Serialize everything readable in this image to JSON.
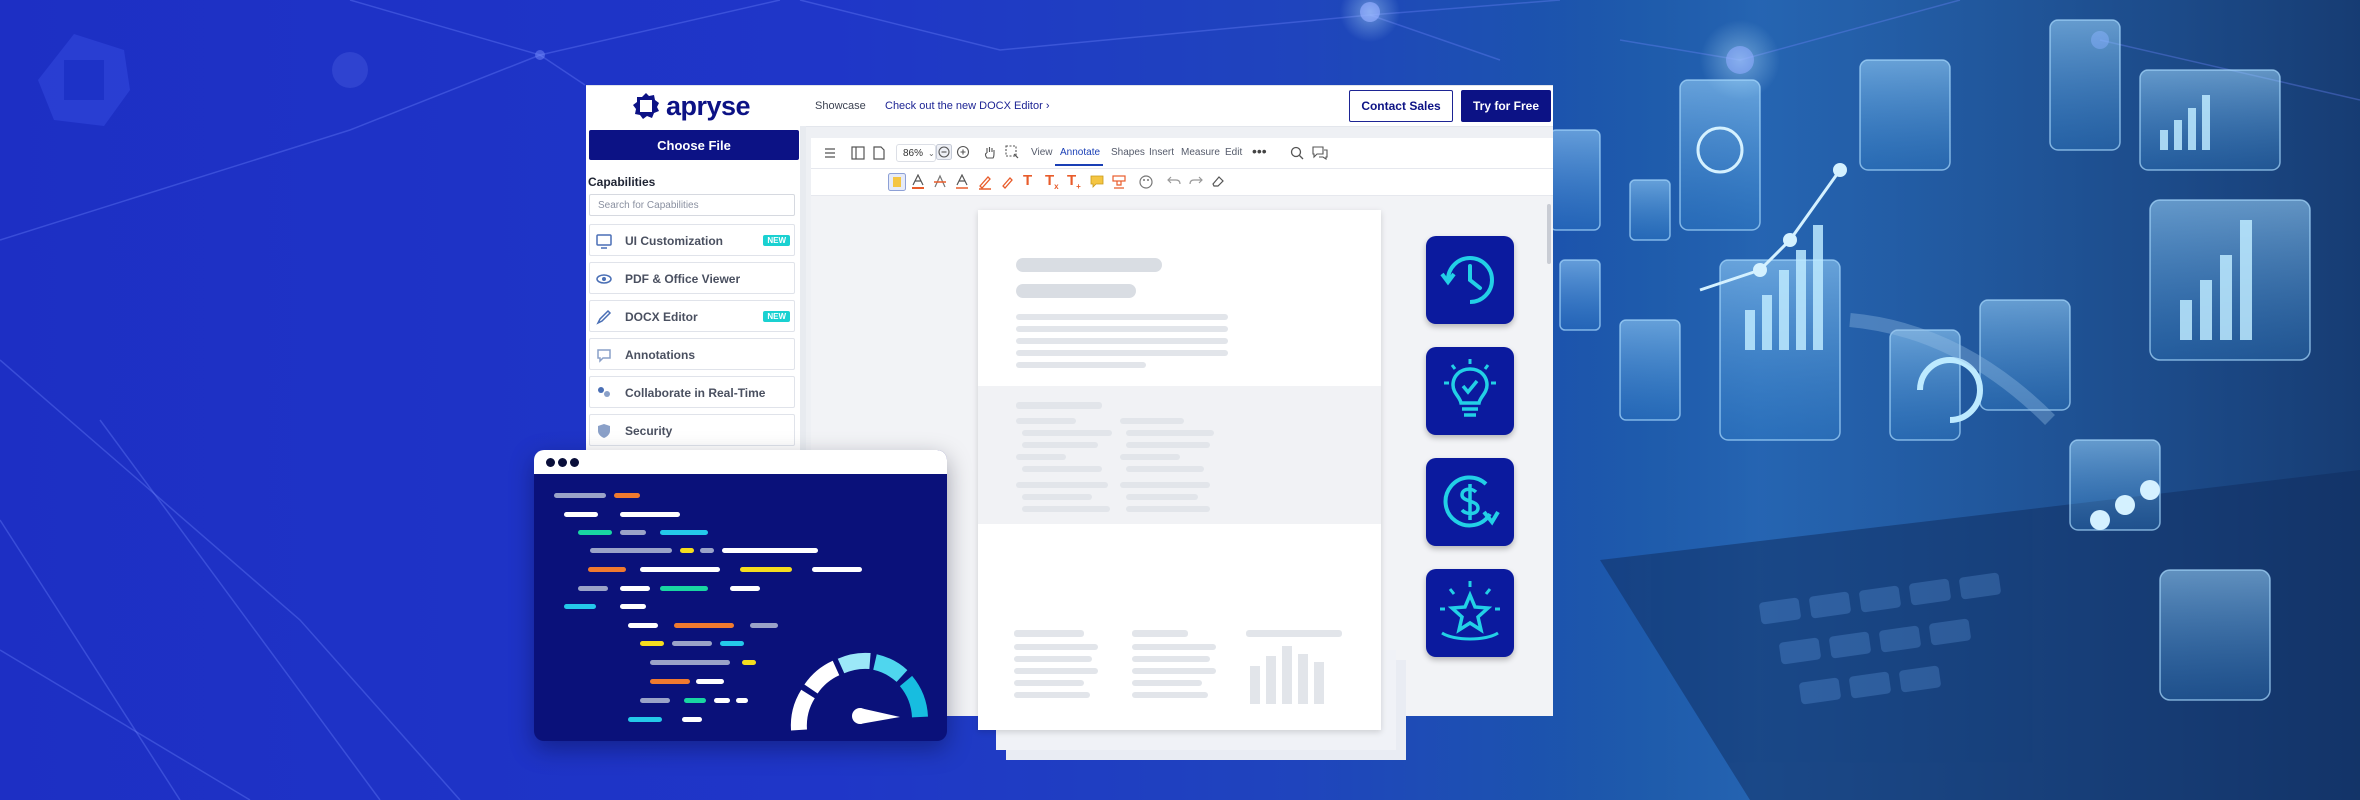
{
  "brand": {
    "logo_text": "apryse",
    "accent": "#0c1285",
    "new_badge_color": "#1ad1d1"
  },
  "topbar": {
    "showcase": "Showcase",
    "docx_link": "Check out the new DOCX Editor",
    "contact_sales": "Contact Sales",
    "try_free": "Try for Free"
  },
  "sidebar": {
    "choose_file": "Choose File",
    "capabilities_title": "Capabilities",
    "search_placeholder": "Search for Capabilities",
    "items": [
      {
        "label": "UI Customization",
        "icon": "monitor-icon",
        "badge": "NEW"
      },
      {
        "label": "PDF & Office Viewer",
        "icon": "eye-icon"
      },
      {
        "label": "DOCX Editor",
        "icon": "pen-icon",
        "badge": "NEW"
      },
      {
        "label": "Annotations",
        "icon": "comment-icon"
      },
      {
        "label": "Collaborate in Real-Time",
        "icon": "collaborate-icon"
      },
      {
        "label": "Security",
        "icon": "shield-icon"
      }
    ]
  },
  "viewer": {
    "zoom": "86%",
    "tabs": [
      "View",
      "Annotate",
      "Shapes",
      "Insert",
      "Measure",
      "Edit"
    ],
    "active_tab": "Annotate"
  },
  "feature_tiles": [
    "clock-rotate-icon",
    "lightbulb-check-icon",
    "dollar-arrow-icon",
    "star-burst-icon"
  ]
}
